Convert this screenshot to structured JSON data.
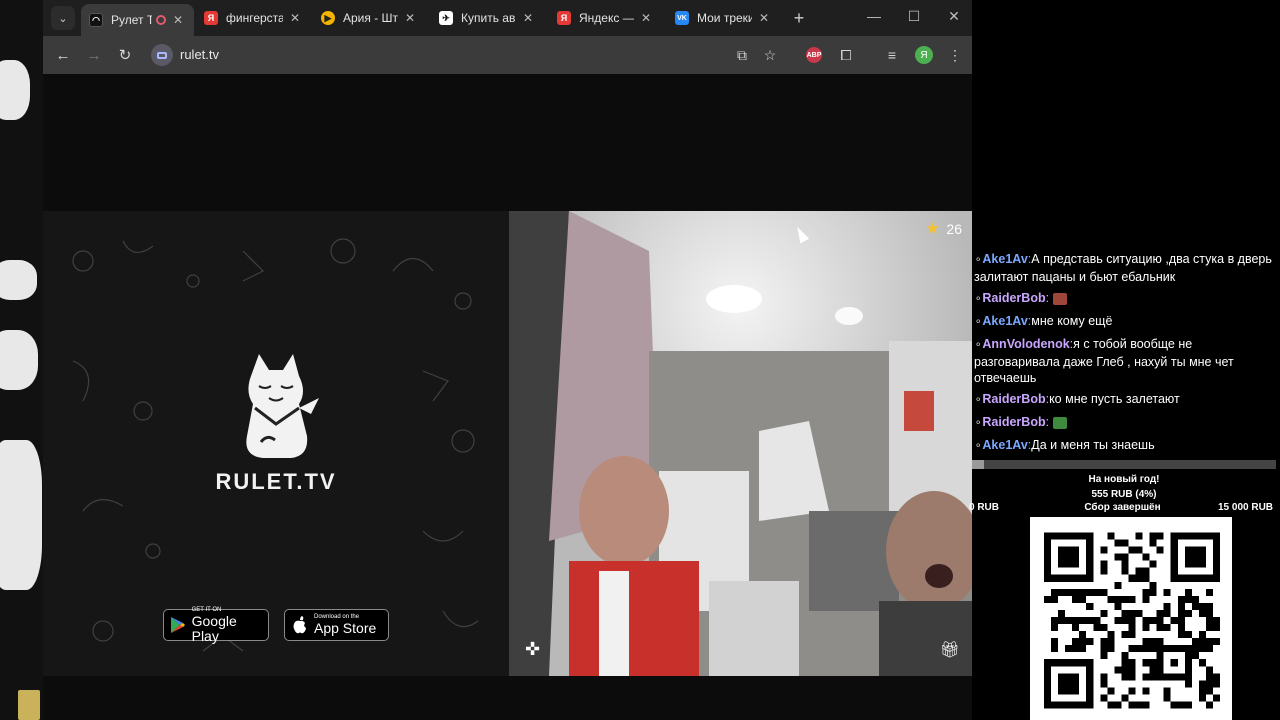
{
  "browser": {
    "tabs": [
      {
        "title": "Рулет Т",
        "active": true,
        "favicon": "rulet-favicon",
        "recording": true
      },
      {
        "title": "фингерстай",
        "favicon": "yandex-favicon",
        "color": "#e53935"
      },
      {
        "title": "Ария - Шти",
        "favicon": "play-favicon",
        "color": "#f4b400"
      },
      {
        "title": "Купить ави",
        "favicon": "aviasales-favicon",
        "color": "#ffffff"
      },
      {
        "title": "Яндекс — б",
        "favicon": "yandex-favicon",
        "color": "#e53935"
      },
      {
        "title": "Мои треки",
        "favicon": "vk-favicon",
        "color": "#2787f5"
      }
    ],
    "url": "rulet.tv",
    "profile_initial": "Я",
    "abp_label": "ABP"
  },
  "ad": {
    "brand": "RULET.TV",
    "google_play": {
      "small": "GET IT ON",
      "big": "Google Play"
    },
    "app_store": {
      "small": "Download on the",
      "big": "App Store"
    }
  },
  "video": {
    "stars_count": "26"
  },
  "chat": {
    "messages": [
      {
        "user": "Ake1Av",
        "sep": ":",
        "text": "А представь ситуацию ,два стука в дверь залитают пацаны и бьют ебальник",
        "color": "#7aa8ff"
      },
      {
        "user": "RaiderBob",
        "sep": ":",
        "text": "",
        "emote": "emote-box",
        "color": "#c9a6ff"
      },
      {
        "user": "Ake1Av",
        "sep": ":",
        "text": "мне кому ещё",
        "color": "#7aa8ff"
      },
      {
        "user": "AnnVolodenok",
        "sep": ":",
        "text": "я с тобой вообще не разговаривала даже Глеб , нахуй ты мне чет отвечаешь",
        "color": "#c9a6ff"
      },
      {
        "user": "RaiderBob",
        "sep": ":",
        "text": "ко мне пусть залетают",
        "color": "#c9a6ff"
      },
      {
        "user": "RaiderBob",
        "sep": ":",
        "text": "",
        "emote": "emote-frog",
        "color": "#c9a6ff"
      },
      {
        "user": "Ake1Av",
        "sep": ":",
        "text": "Да и меня ты знаешь",
        "color": "#7aa8ff"
      }
    ]
  },
  "goal": {
    "title": "На новый год!",
    "amount": "555 RUB (4%)",
    "progress": 0.04,
    "min": "0 RUB",
    "status": "Сбор завершён",
    "max": "15 000 RUB"
  }
}
